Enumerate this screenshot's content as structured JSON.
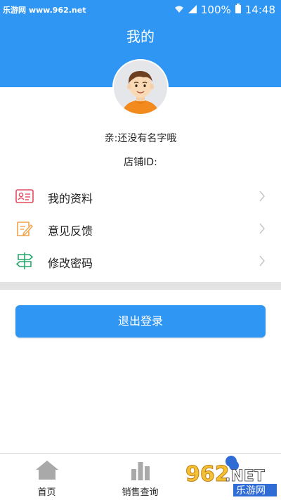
{
  "status_bar": {
    "watermark": "乐游网 www.962.net",
    "battery": "100%",
    "time": "14:48"
  },
  "header": {
    "title": "我的"
  },
  "profile": {
    "nickname": "亲:还没有名字哦",
    "shop_id": "店铺ID:"
  },
  "menu": [
    {
      "label": "我的资料",
      "icon": "profile-card-icon",
      "color": "#e64a5f"
    },
    {
      "label": "意见反馈",
      "icon": "feedback-note-icon",
      "color": "#f2a24a"
    },
    {
      "label": "修改密码",
      "icon": "signpost-icon",
      "color": "#25a86a"
    }
  ],
  "logout": {
    "label": "退出登录"
  },
  "bottom_nav": {
    "items": [
      {
        "label": "首页",
        "icon": "home-icon"
      },
      {
        "label": "销售查询",
        "icon": "bar-chart-icon"
      },
      {
        "label": "",
        "icon": "user-icon"
      }
    ]
  },
  "brand_logo": {
    "text1": "962",
    "text2": ".NET",
    "text3": "乐游网"
  },
  "colors": {
    "primary": "#2f96f3",
    "band": "#e3e3e3"
  }
}
